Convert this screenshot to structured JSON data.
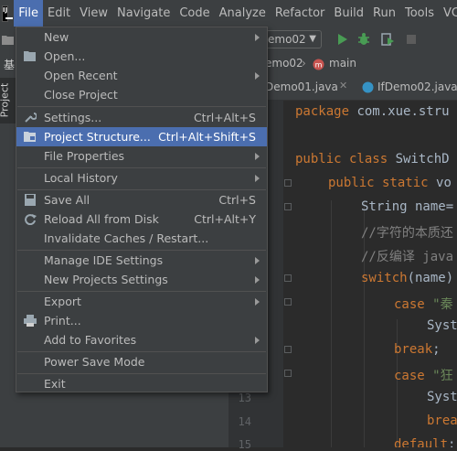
{
  "menubar": {
    "logo_text": "IJ",
    "items": [
      "File",
      "Edit",
      "View",
      "Navigate",
      "Code",
      "Analyze",
      "Refactor",
      "Build",
      "Run",
      "Tools",
      "VCS"
    ]
  },
  "toolbar": {
    "run_config": "emo02"
  },
  "navbar": {
    "crumb1": "emo02",
    "crumb2": "main"
  },
  "tabs": {
    "tab1": "Demo01.java",
    "tab2": "IfDemo02.java"
  },
  "left_panel": {
    "project_tab": "Project",
    "partial_text": "基"
  },
  "file_menu": {
    "items": [
      {
        "label": "New"
      },
      {
        "label": "Open..."
      },
      {
        "label": "Open Recent"
      },
      {
        "label": "Close Project"
      },
      {
        "label": "Settings...",
        "shortcut": "Ctrl+Alt+S"
      },
      {
        "label": "Project Structure...",
        "shortcut": "Ctrl+Alt+Shift+S"
      },
      {
        "label": "File Properties"
      },
      {
        "label": "Local History"
      },
      {
        "label": "Save All",
        "shortcut": "Ctrl+S"
      },
      {
        "label": "Reload All from Disk",
        "shortcut": "Ctrl+Alt+Y"
      },
      {
        "label": "Invalidate Caches / Restart..."
      },
      {
        "label": "Manage IDE Settings"
      },
      {
        "label": "New Projects Settings"
      },
      {
        "label": "Export"
      },
      {
        "label": "Print..."
      },
      {
        "label": "Add to Favorites"
      },
      {
        "label": "Power Save Mode"
      },
      {
        "label": "Exit"
      }
    ]
  },
  "editor": {
    "line_numbers": [
      "13",
      "14",
      "15"
    ],
    "lines": {
      "l1_kw": "package ",
      "l1_rest": "com.xue.stru",
      "l2_kw": "public class ",
      "l2_rest": "SwitchD",
      "l3_kw": "public static ",
      "l3_rest": "vo",
      "l4": "String name=",
      "l5": "//字符的本质还",
      "l6": "//反编译 java",
      "l7_kw": "switch",
      "l7_rest": "(name)",
      "l8_kw": "case ",
      "l8_str": "\"秦",
      "l9": "Syst",
      "l10_kw": "break",
      "l10_rest": ";",
      "l11_kw": "case ",
      "l11_str": "\"狂",
      "l12": "Syst",
      "l13_kw": "brea",
      "l14_kw": "default",
      "l14_rest": ":"
    }
  },
  "colors": {
    "menu_highlight": "#4b6eaf",
    "keyword": "#cc7832",
    "comment": "#808080",
    "string": "#6a8759",
    "run_green": "#499c54"
  }
}
